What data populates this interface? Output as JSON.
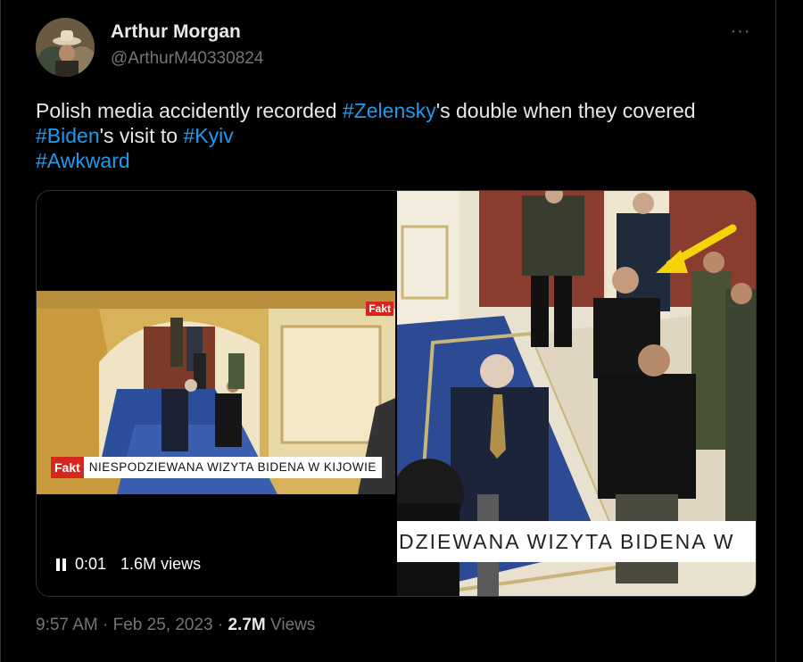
{
  "author": {
    "name": "Arthur Morgan",
    "handle": "@ArthurM40330824",
    "avatar_icon": "avatar-hat-icon"
  },
  "more_label": "···",
  "tweet": {
    "parts": [
      {
        "t": "Polish media accidently recorded "
      },
      {
        "t": "#Zelensky",
        "tag": true
      },
      {
        "t": "'s double when they covered "
      },
      {
        "br": true
      },
      {
        "t": "#Biden",
        "tag": true
      },
      {
        "t": "'s visit to "
      },
      {
        "t": "#Kyiv",
        "tag": true
      },
      {
        "br": true
      },
      {
        "t": "#Awkward",
        "tag": true
      }
    ]
  },
  "media": {
    "left_video": {
      "logo": "Fakt",
      "corner_logo": "Fakt",
      "lower_third": "NIESPODZIEWANA WIZYTA BIDENA W KIJOWIE",
      "time": "0:01",
      "views": "1.6M views"
    },
    "right_image": {
      "banner": "DZIEWANA WIZYTA BIDENA W"
    }
  },
  "meta": {
    "time": "9:57 AM",
    "sep1": " · ",
    "date": "Feb 25, 2023",
    "sep2": " · ",
    "views_count": "2.7M",
    "views_label": " Views"
  },
  "colors": {
    "background": "#000000",
    "text": "#e7e9ea",
    "secondary": "#71767b",
    "hashtag": "#1d9bf0",
    "arrow": "#f5d20a",
    "fakt_red": "#d7261e"
  }
}
